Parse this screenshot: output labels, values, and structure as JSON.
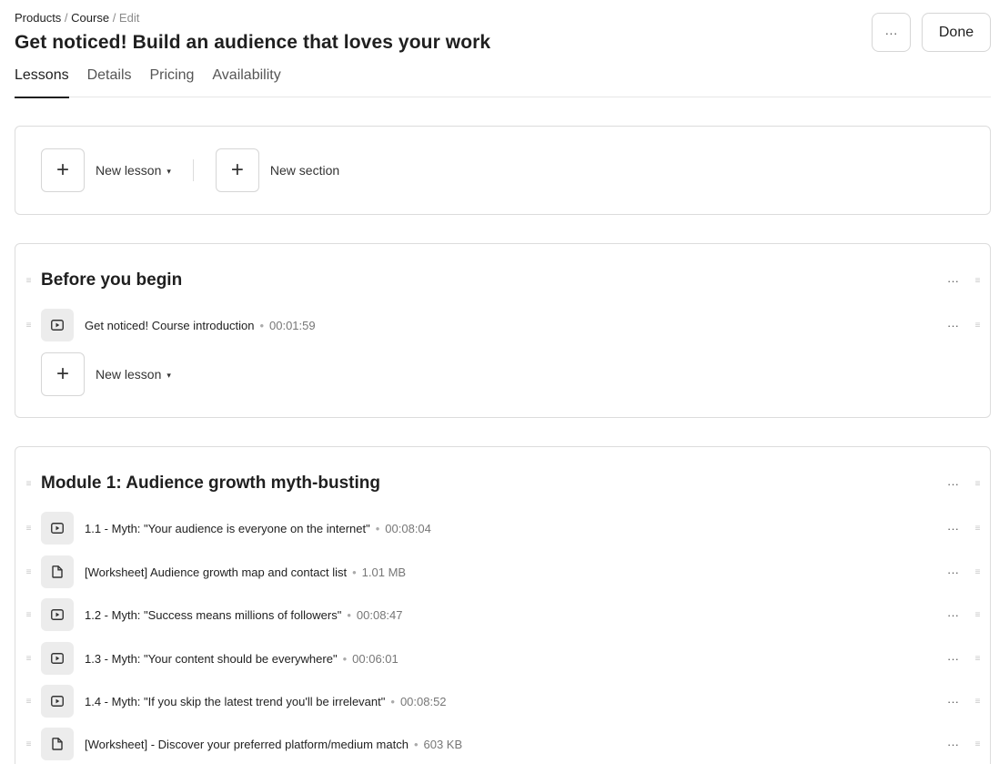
{
  "breadcrumb": {
    "products": "Products",
    "sep1": " / ",
    "course": "Course",
    "sep2": " / ",
    "current": "Edit"
  },
  "page_title": "Get noticed! Build an audience that loves your work",
  "header_actions": {
    "more_label": "···",
    "done_label": "Done"
  },
  "tabs": [
    {
      "label": "Lessons",
      "active": true
    },
    {
      "label": "Details",
      "active": false
    },
    {
      "label": "Pricing",
      "active": false
    },
    {
      "label": "Availability",
      "active": false
    }
  ],
  "toolbar": {
    "plus_symbol": "+",
    "new_lesson_label": "New lesson",
    "new_section_label": "New section",
    "caret": "▾"
  },
  "sections": [
    {
      "title": "Before you begin",
      "more_label": "···",
      "lessons": [
        {
          "icon": "video-icon",
          "title": "Get noticed! Course introduction",
          "meta": "00:01:59",
          "more_label": "···"
        }
      ],
      "add_lesson_label": "New lesson"
    },
    {
      "title": "Module 1: Audience growth myth-busting",
      "more_label": "···",
      "lessons": [
        {
          "icon": "video-icon",
          "title": "1.1 - Myth: \"Your audience is everyone on the internet\"",
          "meta": "00:08:04",
          "more_label": "···"
        },
        {
          "icon": "file-icon",
          "title": "[Worksheet] Audience growth map and contact list",
          "meta": "1.01 MB",
          "more_label": "···"
        },
        {
          "icon": "video-icon",
          "title": "1.2 - Myth: \"Success means millions of followers\"",
          "meta": "00:08:47",
          "more_label": "···"
        },
        {
          "icon": "video-icon",
          "title": "1.3 - Myth: \"Your content should be everywhere\"",
          "meta": "00:06:01",
          "more_label": "···"
        },
        {
          "icon": "video-icon",
          "title": "1.4 - Myth: \"If you skip the latest trend you'll be irrelevant\"",
          "meta": "00:08:52",
          "more_label": "···"
        },
        {
          "icon": "file-icon",
          "title": "[Worksheet] - Discover your preferred platform/medium match",
          "meta": "603 KB",
          "more_label": "···"
        }
      ]
    }
  ],
  "colors": {
    "text": "#1f1f1f",
    "muted": "#777777",
    "border": "#dcdcdc",
    "icon_bg": "#ececec"
  }
}
